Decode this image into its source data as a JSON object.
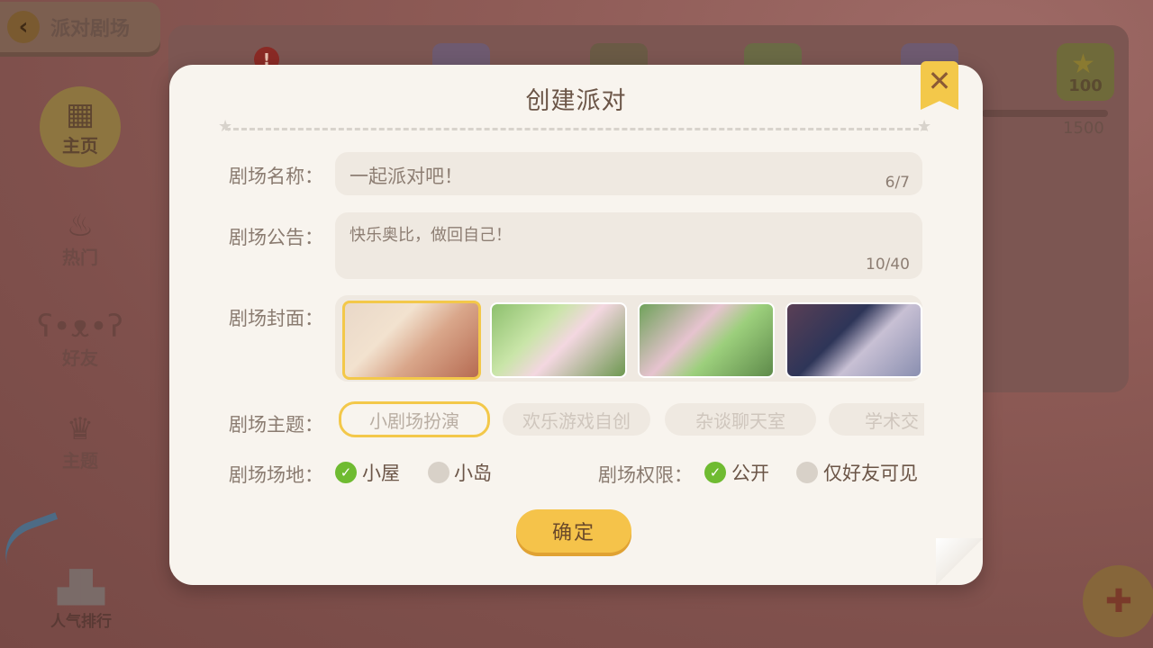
{
  "header": {
    "back_label": "派对剧场"
  },
  "sidebar": {
    "items": [
      {
        "label": "主页",
        "icon": "grid-icon"
      },
      {
        "label": "热门",
        "icon": "fire-icon"
      },
      {
        "label": "好友",
        "icon": "bear-icon"
      },
      {
        "label": "主题",
        "icon": "crown-icon"
      }
    ],
    "rank_label": "人气排行"
  },
  "rewards": {
    "gold_value": "100",
    "progress_text": "1500"
  },
  "dialog": {
    "title": "创建派对",
    "close_icon": "close-icon",
    "name_label": "剧场名称：",
    "name_value": "一起派对吧！",
    "name_counter": "6/7",
    "notice_label": "剧场公告：",
    "notice_value": "快乐奥比，做回自己！",
    "notice_counter": "10/40",
    "cover_label": "剧场封面：",
    "theme_label": "剧场主题：",
    "themes": [
      "小剧场扮演",
      "欢乐游戏自创",
      "杂谈聊天室",
      "学术交"
    ],
    "venue_label": "剧场场地：",
    "venue_options": [
      "小屋",
      "小岛"
    ],
    "venue_selected": "小屋",
    "permission_label": "剧场权限：",
    "permission_options": [
      "公开",
      "仅好友可见"
    ],
    "permission_selected": "公开",
    "confirm_label": "确定"
  },
  "colors": {
    "accent_yellow": "#f3c84a",
    "check_green": "#6fbb31",
    "dialog_bg": "#f8f4ee",
    "input_bg": "#efe9e1"
  }
}
